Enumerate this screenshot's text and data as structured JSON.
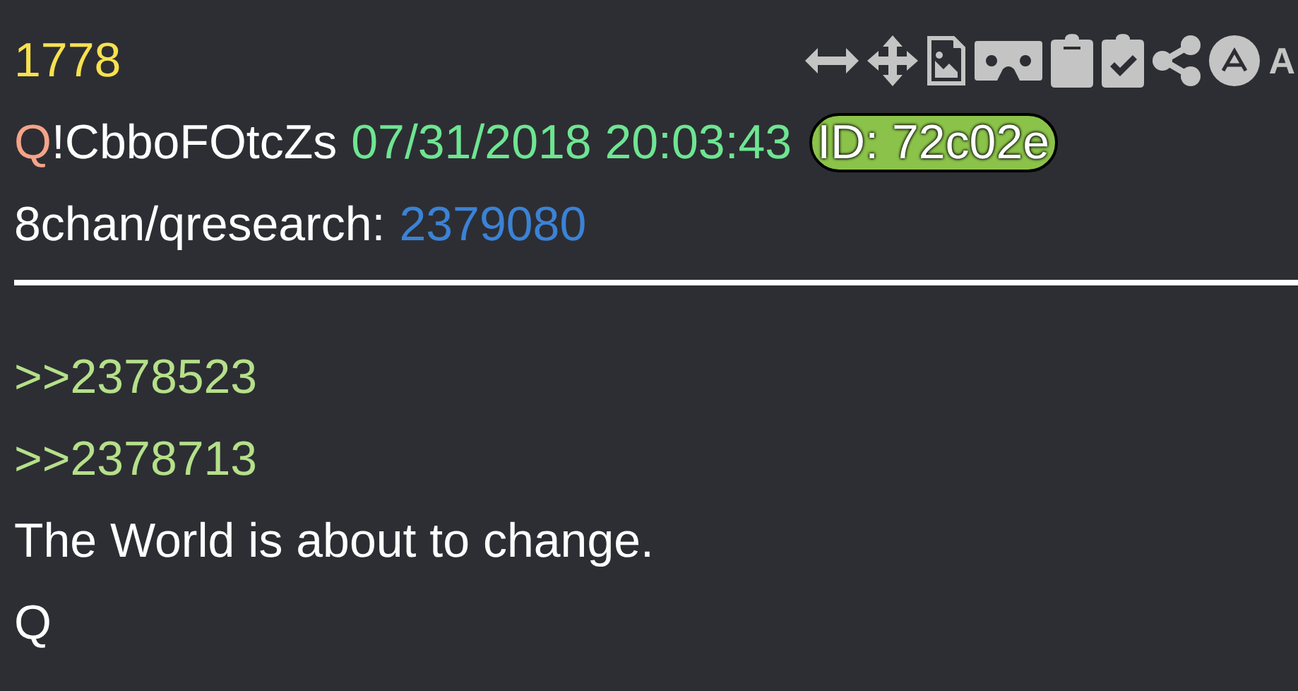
{
  "post": {
    "number": "1778",
    "toolbar_text": "A",
    "author": {
      "name": "Q",
      "trip": "!CbboFOtcZs"
    },
    "timestamp": "07/31/2018 20:03:43",
    "id_badge": {
      "label": "ID: 72c02e",
      "color": "#8bc34a"
    },
    "source": {
      "board": "8chan/qresearch:",
      "post_link": "2379080"
    },
    "replies": [
      ">>2378523",
      ">>2378713"
    ],
    "body": [
      "The World is about to change.",
      "Q"
    ]
  }
}
